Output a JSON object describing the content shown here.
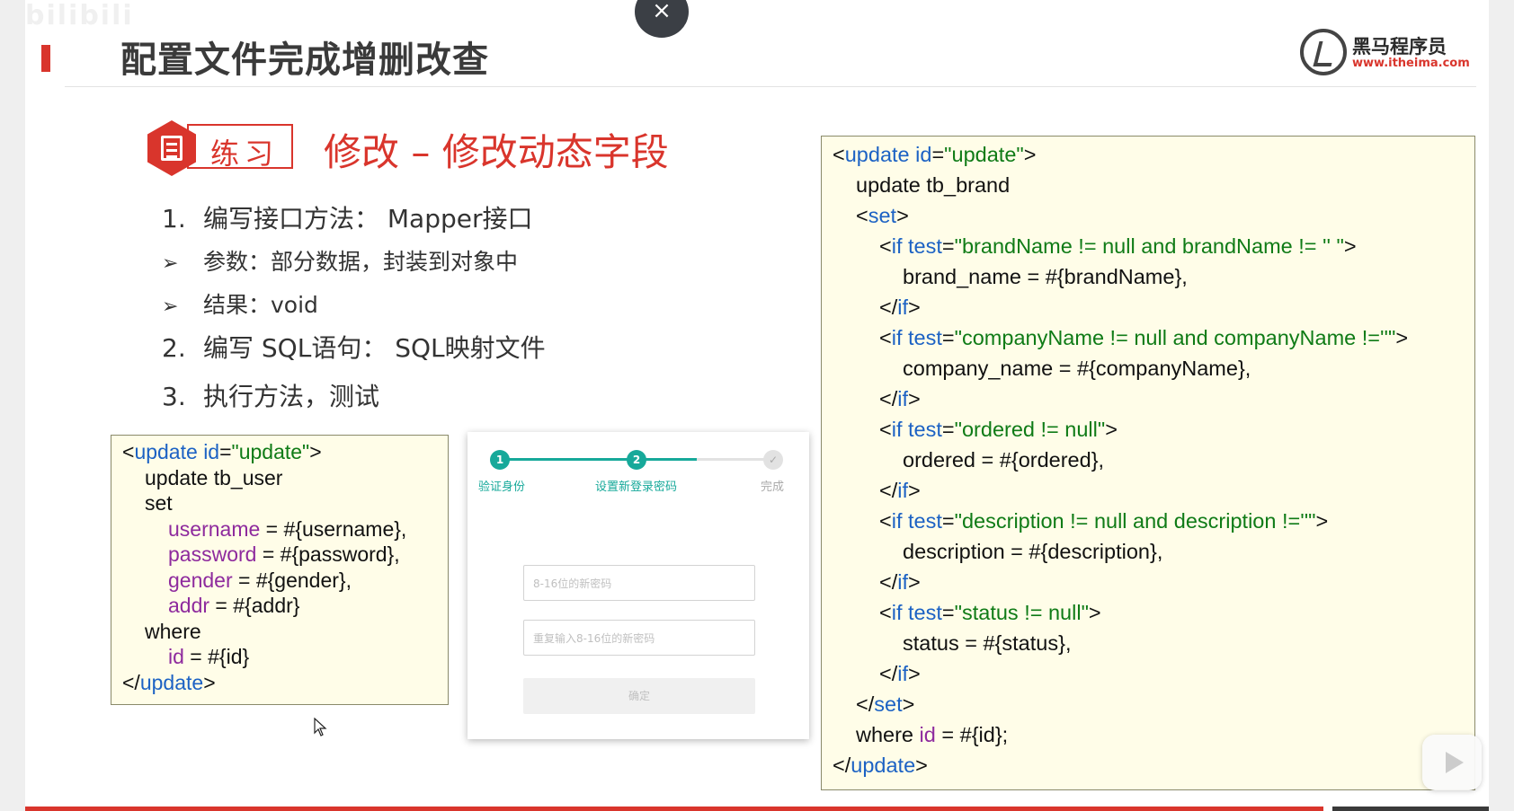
{
  "watermark": "bilibili",
  "close_glyph": "×",
  "header": {
    "title": "配置文件完成增删改查",
    "logo_name": "黑马程序员",
    "logo_url": "www.itheima.com"
  },
  "exercise": {
    "badge_label": "练习",
    "title": "修改 – 修改动态字段"
  },
  "steps": [
    {
      "marker": "1.",
      "text": "编写接口方法：  Mapper接口"
    },
    {
      "marker": "➢",
      "text": "参数：部分数据，封装到对象中"
    },
    {
      "marker": "➢",
      "text": "结果：void"
    },
    {
      "marker": "2.",
      "text": "编写 SQL语句：  SQL映射文件"
    },
    {
      "marker": "3.",
      "text": "执行方法，测试"
    }
  ],
  "code_left": {
    "l1": {
      "a": "<",
      "b": "update ",
      "c": "id",
      "d": "=",
      "e": "\"update\"",
      "f": ">"
    },
    "l2": "update tb_user",
    "l3": "set",
    "l4": {
      "a": "username",
      "b": " = #{username},"
    },
    "l5": {
      "a": "password",
      "b": " = #{password},"
    },
    "l6": {
      "a": "gender",
      "b": " = #{gender},"
    },
    "l7": {
      "a": "addr",
      "b": " = #{addr}"
    },
    "l8": "where",
    "l9": {
      "a": "id",
      "b": " = #{id}"
    },
    "l10": {
      "a": "</",
      "b": "update",
      "c": ">"
    }
  },
  "code_right": {
    "l1": {
      "a": "<",
      "b": "update ",
      "c": "id",
      "d": "=",
      "e": "\"update\"",
      "f": ">"
    },
    "l2": "update tb_brand",
    "l3": {
      "a": "<",
      "b": "set",
      "c": ">"
    },
    "l4": {
      "a": "<",
      "b": "if ",
      "c": "test",
      "d": "=",
      "e": "\"brandName != null and brandName != '' \"",
      "f": ">"
    },
    "l5": "brand_name = #{brandName},",
    "l6": {
      "a": "</",
      "b": "if",
      "c": ">"
    },
    "l7": {
      "a": "<",
      "b": "if ",
      "c": "test",
      "d": "=",
      "e": "\"companyName != null and companyName !=''\"",
      "f": ">"
    },
    "l8": "company_name = #{companyName},",
    "l9": {
      "a": "</",
      "b": "if",
      "c": ">"
    },
    "l10": {
      "a": "<",
      "b": "if ",
      "c": "test",
      "d": "=",
      "e": "\"ordered != null\"",
      "f": ">"
    },
    "l11": "ordered = #{ordered},",
    "l12": {
      "a": "</",
      "b": "if",
      "c": ">"
    },
    "l13": {
      "a": "<",
      "b": "if ",
      "c": "test",
      "d": "=",
      "e": "\"description != null and description !=''\"",
      "f": ">"
    },
    "l14": "description = #{description},",
    "l15": {
      "a": "</",
      "b": "if",
      "c": ">"
    },
    "l16": {
      "a": "<",
      "b": "if ",
      "c": "test",
      "d": "=",
      "e": "\"status != null\"",
      "f": ">"
    },
    "l17": "status = #{status},",
    "l18": {
      "a": "</",
      "b": "if",
      "c": ">"
    },
    "l19": {
      "a": "</",
      "b": "set",
      "c": ">"
    },
    "l20": {
      "a": "where ",
      "b": "id",
      "c": " = #{id};"
    },
    "l21": {
      "a": "</",
      "b": "update",
      "c": ">"
    }
  },
  "form": {
    "steps": [
      {
        "num": "1",
        "label": "验证身份"
      },
      {
        "num": "2",
        "label": "设置新登录密码"
      },
      {
        "num": "✓",
        "label": "完成"
      }
    ],
    "progress": 0.72,
    "new_password_placeholder": "8-16位的新密码",
    "confirm_password_placeholder": "重复输入8-16位的新密码",
    "submit_label": "确定"
  },
  "colors": {
    "accent": "#d9352c",
    "keyword": "#1c62c4",
    "string": "#0f7b16",
    "variable": "#8e2a9d",
    "progress": "#17a99a",
    "code_bg": "#fffde8"
  },
  "icons": {
    "close": "close-icon",
    "exercise": "document-icon",
    "logo": "itheima-logo",
    "play": "play-icon"
  }
}
